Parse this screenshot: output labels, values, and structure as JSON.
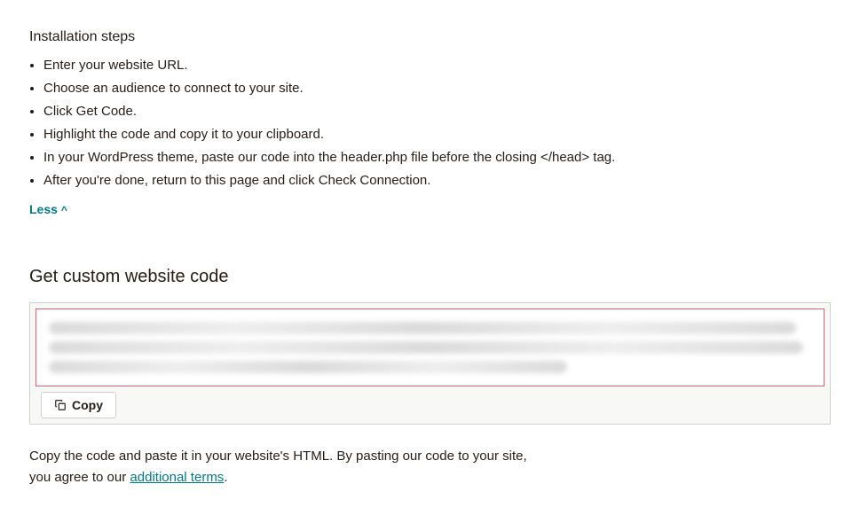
{
  "installation": {
    "heading": "Installation steps",
    "steps": [
      "Enter your website URL.",
      "Choose an audience to connect to your site.",
      "Click Get Code.",
      "Highlight the code and copy it to your clipboard.",
      "In your WordPress theme, paste our code into the header.php file before the closing </head> tag.",
      "After you're done, return to this page and click Check Connection."
    ],
    "toggle_label": "Less"
  },
  "custom_code": {
    "title": "Get custom website code",
    "copy_label": "Copy"
  },
  "footer": {
    "line1": "Copy the code and paste it in your website's HTML. By pasting our code to your site,",
    "line2_prefix": "you agree to our ",
    "terms_link": "additional terms",
    "line2_suffix": "."
  }
}
